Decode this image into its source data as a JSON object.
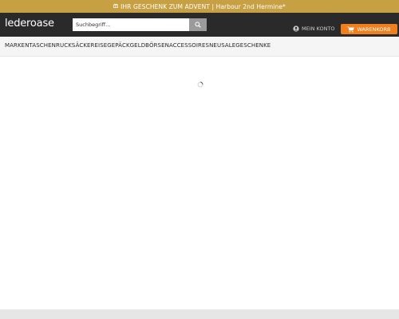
{
  "promo": {
    "icon": "gift-icon",
    "text": "IHR GESCHENK ZUM ADVENT | Harbour 2nd Hermine*"
  },
  "header": {
    "logo": "lederoase",
    "search": {
      "placeholder": "Suchbegriff..."
    },
    "account_label": "MEIN KONTO",
    "cart_label": "WARENKORB"
  },
  "nav": {
    "items": [
      "MARKEN",
      "TASCHEN",
      "RUCKSÄCKE",
      "REISEGEPÄCK",
      "GELDBÖRSEN",
      "ACCESSOIRES",
      "NEU",
      "SALE",
      "GESCHENKE"
    ]
  },
  "colors": {
    "promo_bg": "#c8a044",
    "header_bg": "#2a2a2a",
    "cart_accent": "#f0801e"
  }
}
